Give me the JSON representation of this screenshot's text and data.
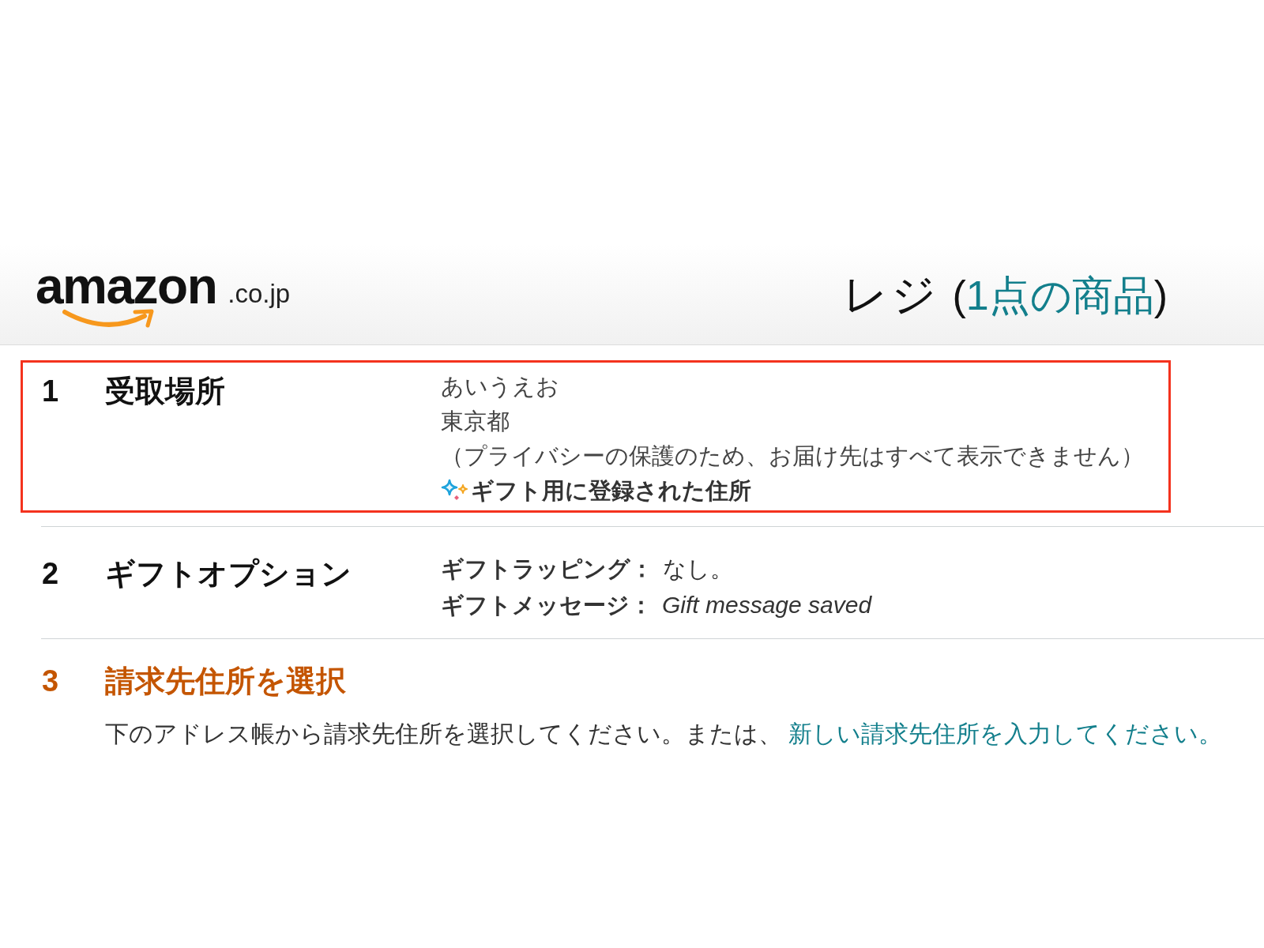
{
  "header": {
    "logo": {
      "wordmark": "amazon",
      "suffix": ".co.jp"
    },
    "title": "レジ",
    "item_count": {
      "open": "(",
      "link": "1点の商品",
      "close": ")"
    }
  },
  "steps": [
    {
      "kind": "address",
      "number": "1",
      "title": "受取場所",
      "active": false,
      "highlighted": true,
      "lines": [
        "あいうえお",
        "東京都",
        "（プライバシーの保護のため、お届け先はすべて表示できません）"
      ],
      "badge": "ギフト用に登録された住所"
    },
    {
      "kind": "options",
      "number": "2",
      "title": "ギフトオプション",
      "active": false,
      "highlighted": false,
      "rows": [
        {
          "label": "ギフトラッピング：",
          "value": "なし。",
          "italic": false
        },
        {
          "label": "ギフトメッセージ：",
          "value": "Gift message saved",
          "italic": true
        }
      ]
    },
    {
      "kind": "instruction",
      "number": "3",
      "title": "請求先住所を選択",
      "active": true,
      "highlighted": false,
      "text": "下のアドレス帳から請求先住所を選択してください。または、",
      "link": "新しい請求先住所を入力してください。"
    }
  ]
}
